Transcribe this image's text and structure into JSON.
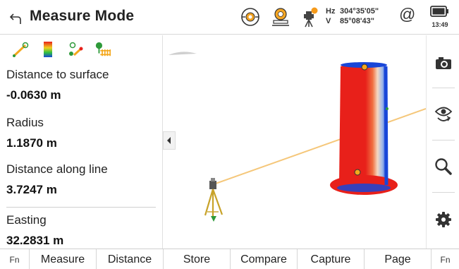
{
  "header": {
    "title": "Measure Mode",
    "hz_label": "Hz",
    "hz_value": "304°35'05\"",
    "v_label": "V",
    "v_value": "85°08'43\"",
    "at_symbol": "@",
    "time": "13:49"
  },
  "left_panel": {
    "tools": [
      "measure-distance-icon",
      "color-scale-icon",
      "compare-points-icon",
      "vegetation-icon"
    ],
    "fields": [
      {
        "label": "Distance to surface",
        "value": "-0.0630 m"
      },
      {
        "label": "Radius",
        "value": "1.1870 m"
      },
      {
        "label": "Distance along line",
        "value": "3.7247 m"
      },
      {
        "label": "Easting",
        "value": "32.2831 m"
      }
    ]
  },
  "right_toolbar": [
    "camera-icon",
    "eye-rotate-icon",
    "zoom-icon",
    "settings-icon"
  ],
  "softkeys": {
    "fn_left": "Fn",
    "measure": "Measure",
    "distance": "Distance",
    "store": "Store",
    "compare": "Compare",
    "capture": "Capture",
    "page": "Page",
    "fn_right": "Fn"
  },
  "colors": {
    "cloud_red": "#e8201a",
    "cloud_blue": "#1846d8",
    "line": "#f5c77a",
    "tripod": "#c8a32a",
    "accent_green": "#2e9a3a"
  }
}
